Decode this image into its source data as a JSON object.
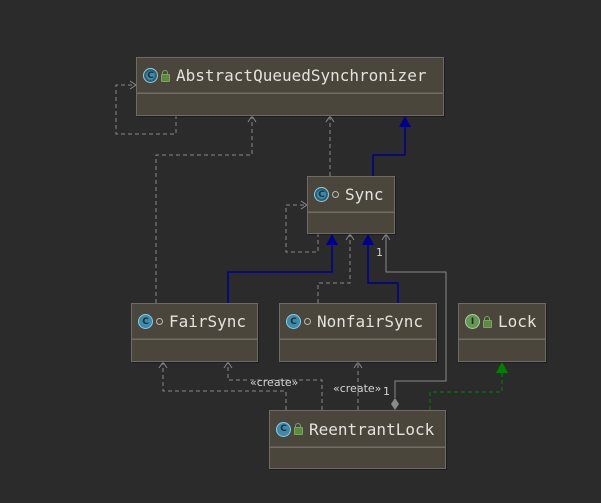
{
  "diagram": {
    "classes": [
      {
        "id": "aqs",
        "name": "AbstractQueuedSynchronizer",
        "kind": "abstract-class",
        "visibility": "public"
      },
      {
        "id": "sync",
        "name": "Sync",
        "kind": "abstract-class",
        "visibility": "package"
      },
      {
        "id": "fair",
        "name": "FairSync",
        "kind": "class",
        "visibility": "package"
      },
      {
        "id": "nonfair",
        "name": "NonfairSync",
        "kind": "class",
        "visibility": "package"
      },
      {
        "id": "lock",
        "name": "Lock",
        "kind": "interface",
        "visibility": "public"
      },
      {
        "id": "reentrant",
        "name": "ReentrantLock",
        "kind": "class",
        "visibility": "public"
      }
    ],
    "relations": [
      {
        "from": "sync",
        "to": "aqs",
        "type": "generalization"
      },
      {
        "from": "fair",
        "to": "sync",
        "type": "generalization"
      },
      {
        "from": "nonfair",
        "to": "sync",
        "type": "generalization"
      },
      {
        "from": "reentrant",
        "to": "lock",
        "type": "realization"
      },
      {
        "from": "reentrant",
        "to": "fair",
        "type": "create",
        "label": "«create»"
      },
      {
        "from": "reentrant",
        "to": "nonfair",
        "type": "create",
        "label": "«create»"
      },
      {
        "from": "reentrant",
        "to": "sync",
        "type": "aggregation",
        "source_multiplicity": "1",
        "target_multiplicity": "1"
      },
      {
        "from": "aqs",
        "to": "aqs",
        "type": "dependency"
      },
      {
        "from": "sync",
        "to": "sync",
        "type": "dependency"
      },
      {
        "from": "fair",
        "to": "aqs",
        "type": "dependency"
      },
      {
        "from": "nonfair",
        "to": "sync",
        "type": "dependency"
      },
      {
        "from": "reentrant",
        "to": "sync",
        "type": "dependency"
      }
    ],
    "icons": {
      "class": "class-icon",
      "interface": "interface-icon",
      "public": "public-lock-icon",
      "package": "package-visibility-icon"
    },
    "colors": {
      "background": "#2b2b2b",
      "node_fill": "#4a463c",
      "node_border": "#6f6c62",
      "generalization": "#00008b",
      "realization": "#008000",
      "dependency": "#808080",
      "text": "#e3e2dc"
    }
  }
}
